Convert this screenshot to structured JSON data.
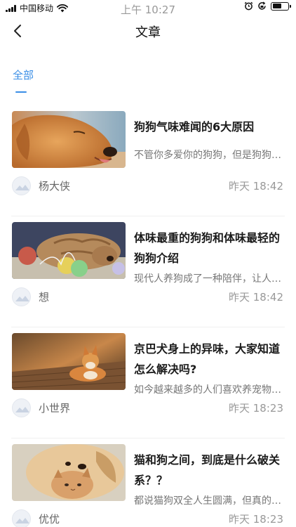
{
  "status_bar": {
    "carrier": "中国移动",
    "time": "上午 10:27",
    "battery_level": 0.6
  },
  "nav": {
    "title": "文章",
    "back_icon": "chevron-left-icon"
  },
  "tabs": [
    {
      "label": "全部",
      "active": true
    }
  ],
  "articles": [
    {
      "title": "狗狗气味难闻的6大原因",
      "summary": "不管你多爱你的狗狗，但是狗狗身上的气味",
      "author": "杨大侠",
      "time": "昨天 18:42",
      "image": "golden-retriever-photo"
    },
    {
      "title": "体味最重的狗狗和体味最轻的狗狗介绍",
      "summary": "现代人养狗成了一种陪伴，让人们感到快乐",
      "author": "想",
      "time": "昨天 18:42",
      "image": "shar-pei-with-balloons-photo"
    },
    {
      "title": "京巴犬身上的异味，大家知道怎么解决吗?",
      "summary": "如今越来越多的人们喜欢养宠物狗狗了",
      "author": "小世界",
      "time": "昨天 18:23",
      "image": "corgi-on-wooden-deck-photo"
    },
    {
      "title": "猫和狗之间，到底是什么破关系？？",
      "summary": "都说猫狗双全人生圆满，但真的是这样吗",
      "author": "优优",
      "time": "昨天 18:23",
      "image": "puppy-and-kitten-photo"
    }
  ]
}
